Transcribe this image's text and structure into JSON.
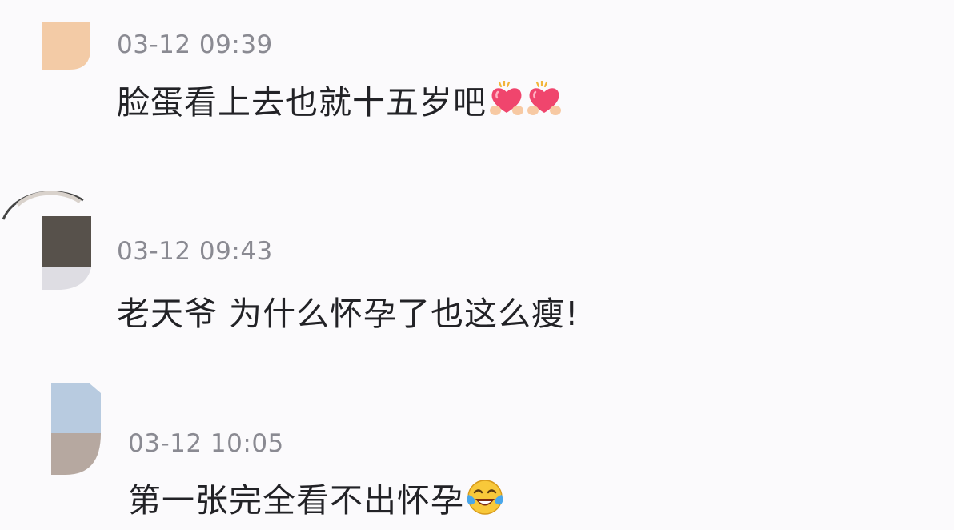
{
  "comments": [
    {
      "timestamp": "03-12 09:39",
      "text": "脸蛋看上去也就十五岁吧",
      "emojis": [
        "heart-hands-emoji",
        "heart-hands-emoji"
      ]
    },
    {
      "timestamp": "03-12 09:43",
      "text": "老天爷 为什么怀孕了也这么瘦!",
      "emojis": []
    },
    {
      "timestamp": "03-12 10:05",
      "text": "第一张完全看不出怀孕",
      "emojis": [
        "laugh-cry-emoji"
      ]
    }
  ],
  "colors": {
    "background": "#fbfafc",
    "timestamp": "#8a8a92",
    "text": "#222226",
    "avatar1": "#f3cba6",
    "avatar2_top": "#57514b",
    "avatar3_top": "#b8cbe0",
    "avatar3_bottom": "#b6a8a0"
  }
}
